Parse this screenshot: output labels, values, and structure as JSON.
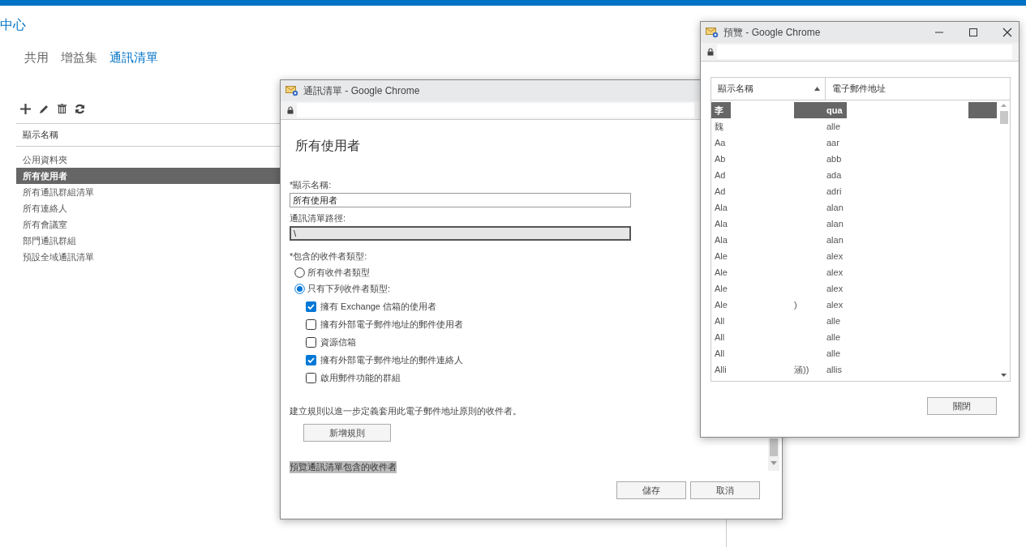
{
  "page": {
    "title": "中心",
    "tabs": [
      {
        "label": "共用",
        "selected": false
      },
      {
        "label": "增益集",
        "selected": false
      },
      {
        "label": "通訊清單",
        "selected": true
      }
    ],
    "list": {
      "header": "顯示名稱",
      "items": [
        {
          "label": "公用資料夾",
          "selected": false
        },
        {
          "label": "所有使用者",
          "selected": true
        },
        {
          "label": "所有通訊群組清單",
          "selected": false
        },
        {
          "label": "所有連絡人",
          "selected": false
        },
        {
          "label": "所有會議室",
          "selected": false
        },
        {
          "label": "部門通訊群組",
          "selected": false
        },
        {
          "label": "預設全域通訊清單",
          "selected": false
        }
      ]
    }
  },
  "dialog": {
    "window_title": "通訊清單 - Google Chrome",
    "heading": "所有使用者",
    "fields": [
      {
        "label": "*顯示名稱:",
        "value": "所有使用者",
        "disabled": false
      },
      {
        "label": "通訊清單路徑:",
        "value": "\\",
        "disabled": true
      }
    ],
    "recipient_label": "*包含的收件者類型:",
    "options": [
      {
        "label": "所有收件者類型",
        "selected": false
      },
      {
        "label": "只有下列收件者類型:",
        "selected": true
      }
    ],
    "types": [
      {
        "label": "擁有 Exchange 信箱的使用者",
        "checked": true
      },
      {
        "label": "擁有外部電子郵件地址的郵件使用者",
        "checked": false
      },
      {
        "label": "資源信箱",
        "checked": false
      },
      {
        "label": "擁有外部電子郵件地址的郵件連絡人",
        "checked": true
      },
      {
        "label": "啟用郵件功能的群組",
        "checked": false
      }
    ],
    "rule_text": "建立規則以進一步定義套用此電子郵件地址原則的收件者。",
    "add_rule_button": "新增規則",
    "preview_link": "預覽通訊清單包含的收件者",
    "buttons": [
      "儲存",
      "取消"
    ]
  },
  "preview": {
    "window_title": "預覽 - Google Chrome",
    "columns": [
      "顯示名稱",
      "電子郵件地址"
    ],
    "rows": [
      {
        "name": "李",
        "email": "qua",
        "selected": true
      },
      {
        "name": "魏",
        "email": "alle",
        "selected": false
      },
      {
        "name": "Aa",
        "email": "aar",
        "selected": false
      },
      {
        "name": "Ab",
        "email": "abb",
        "selected": false
      },
      {
        "name": "Ad",
        "email": "ada",
        "selected": false
      },
      {
        "name": "Ad",
        "email": "adri",
        "selected": false
      },
      {
        "name": "Ala",
        "email": "alan",
        "selected": false
      },
      {
        "name": "Ala",
        "email": "alan",
        "selected": false
      },
      {
        "name": "Ala",
        "email": "alan",
        "selected": false
      },
      {
        "name": "Ale",
        "email": "alex",
        "selected": false
      },
      {
        "name": "Ale",
        "email": "alex",
        "selected": false
      },
      {
        "name": "Ale",
        "email": "alex",
        "selected": false
      },
      {
        "name": "Ale",
        "name_tail": ")",
        "email": "alex",
        "selected": false
      },
      {
        "name": "All",
        "email": "alle",
        "selected": false
      },
      {
        "name": "All",
        "email": "alle",
        "selected": false
      },
      {
        "name": "All",
        "email": "alle",
        "selected": false
      },
      {
        "name": "Alli",
        "name_tail": "涵))",
        "email": "allis",
        "selected": false
      }
    ],
    "close_button": "關閉"
  }
}
